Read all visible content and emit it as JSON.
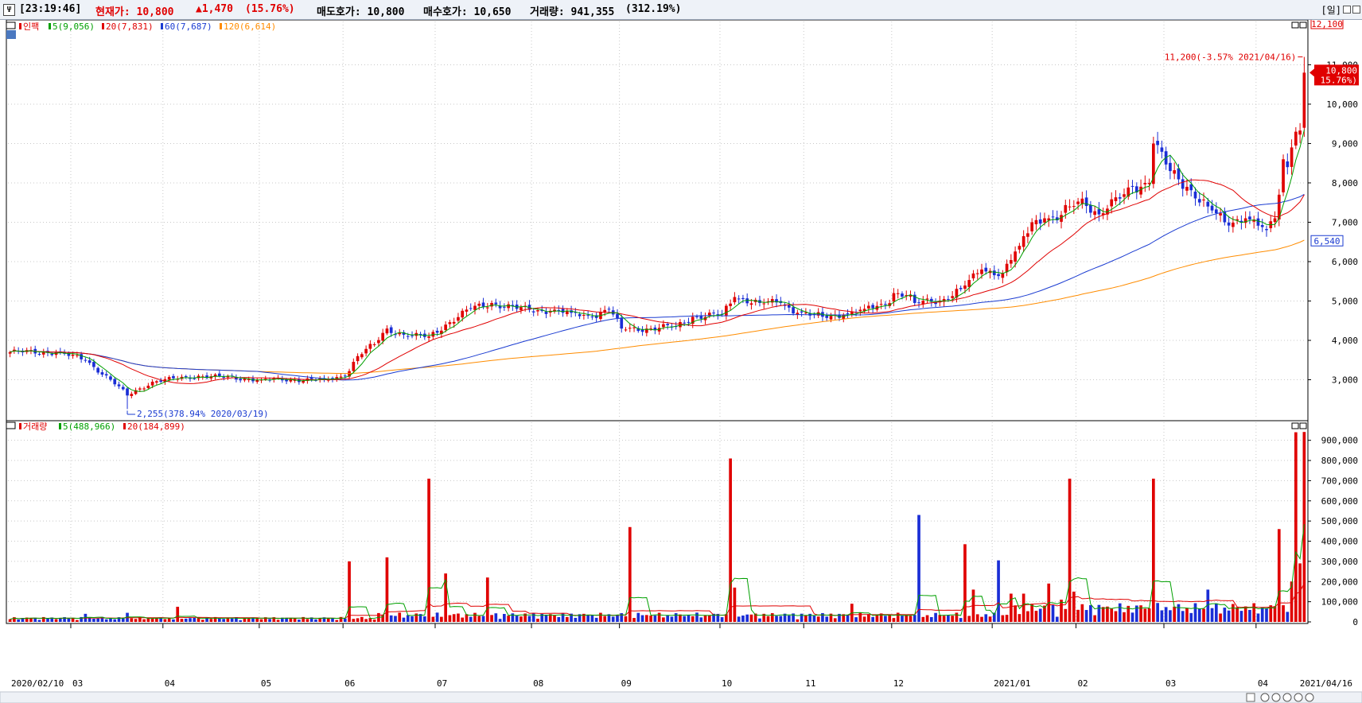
{
  "header": {
    "time": "[23:19:46]",
    "price_label": "현재가: 10,800",
    "change": "▲1,470",
    "change_pct": "(15.76%)",
    "ask": "매도호가: 10,800",
    "bid": "매수호가: 10,650",
    "volume": "거래량: 941,355",
    "volume_pct": "(312.19%)",
    "period": "[일]"
  },
  "price_legend": [
    {
      "text": "인팩",
      "color": "#e00000"
    },
    {
      "text": "5(9,056)",
      "color": "#00a000"
    },
    {
      "text": "20(7,831)",
      "color": "#e00000"
    },
    {
      "text": "60(7,687)",
      "color": "#1a3bd1"
    },
    {
      "text": "120(6,614)",
      "color": "#ff8c00"
    }
  ],
  "volume_legend": [
    {
      "text": "거래량",
      "color": "#e00000"
    },
    {
      "text": "5(488,966)",
      "color": "#00a000"
    },
    {
      "text": "20(184,899)",
      "color": "#e00000"
    }
  ],
  "annotations": {
    "high_label": "11,200(-3.57% 2021/04/16)",
    "low_label": "2,255(378.94% 2020/03/19)",
    "top_box": "12,100",
    "current_box_price": "10,800",
    "current_box_pct": "( 15.76%)",
    "low_box": "6,540"
  },
  "colors": {
    "up": "#e00000",
    "down": "#1a2ed6",
    "ma5": "#00a000",
    "ma20": "#e00000",
    "ma60": "#1a3bd1",
    "ma120": "#ff8c00"
  },
  "chart_data": [
    {
      "type": "candlestick",
      "title": "인팩",
      "ylim": [
        2000,
        12100
      ],
      "y_ticks": [
        3000,
        4000,
        5000,
        6000,
        7000,
        8000,
        9000,
        10000,
        11000
      ],
      "y_tick_labels": [
        "3,000",
        "4,000",
        "5,000",
        "6,000",
        "7,000",
        "8,000",
        "9,000",
        "10,000",
        "11,000"
      ],
      "x_ticks": [
        "2020/02/10",
        "03",
        "04",
        "05",
        "06",
        "07",
        "08",
        "09",
        "10",
        "11",
        "12",
        "2021/01",
        "02",
        "03",
        "04",
        "2021/04/16"
      ],
      "x_tick_dates": [
        "2020-02-10",
        "2020-03-02",
        "2020-04-01",
        "2020-05-04",
        "2020-06-01",
        "2020-07-01",
        "2020-08-03",
        "2020-09-01",
        "2020-10-05",
        "2020-11-02",
        "2020-12-01",
        "2021-01-04",
        "2021-02-01",
        "2021-03-02",
        "2021-04-01",
        "2021-04-16"
      ],
      "close_anchors": [
        [
          "2020-02-10",
          3700
        ],
        [
          "2020-02-25",
          3700
        ],
        [
          "2020-03-05",
          3500
        ],
        [
          "2020-03-13",
          3000
        ],
        [
          "2020-03-19",
          2600
        ],
        [
          "2020-03-27",
          2950
        ],
        [
          "2020-04-13",
          3100
        ],
        [
          "2020-05-04",
          3000
        ],
        [
          "2020-05-25",
          3000
        ],
        [
          "2020-06-01",
          3100
        ],
        [
          "2020-06-04",
          3600
        ],
        [
          "2020-06-10",
          3900
        ],
        [
          "2020-06-15",
          4300
        ],
        [
          "2020-06-22",
          4100
        ],
        [
          "2020-06-29",
          4100
        ],
        [
          "2020-07-03",
          4400
        ],
        [
          "2020-07-13",
          4800
        ],
        [
          "2020-07-20",
          4950
        ],
        [
          "2020-07-28",
          4800
        ],
        [
          "2020-08-07",
          4750
        ],
        [
          "2020-08-14",
          4700
        ],
        [
          "2020-08-21",
          4600
        ],
        [
          "2020-08-27",
          4800
        ],
        [
          "2020-09-01",
          4300
        ],
        [
          "2020-09-10",
          4300
        ],
        [
          "2020-09-18",
          4350
        ],
        [
          "2020-09-24",
          4600
        ],
        [
          "2020-10-05",
          4650
        ],
        [
          "2020-10-08",
          5100
        ],
        [
          "2020-10-16",
          4950
        ],
        [
          "2020-10-23",
          4950
        ],
        [
          "2020-10-29",
          4700
        ],
        [
          "2020-11-06",
          4600
        ],
        [
          "2020-11-13",
          4650
        ],
        [
          "2020-11-20",
          4800
        ],
        [
          "2020-11-27",
          4900
        ],
        [
          "2020-12-01",
          5200
        ],
        [
          "2020-12-04",
          5150
        ],
        [
          "2020-12-08",
          4950
        ],
        [
          "2020-12-17",
          5050
        ],
        [
          "2020-12-23",
          5300
        ],
        [
          "2020-12-30",
          5800
        ],
        [
          "2021-01-06",
          5700
        ],
        [
          "2021-01-12",
          6400
        ],
        [
          "2021-01-15",
          7000
        ],
        [
          "2021-01-20",
          7100
        ],
        [
          "2021-01-25",
          7050
        ],
        [
          "2021-01-28",
          7400
        ],
        [
          "2021-02-02",
          7600
        ],
        [
          "2021-02-08",
          7200
        ],
        [
          "2021-02-15",
          7600
        ],
        [
          "2021-02-18",
          7900
        ],
        [
          "2021-02-24",
          8000
        ],
        [
          "2021-02-25",
          9000
        ],
        [
          "2021-03-03",
          8300
        ],
        [
          "2021-03-09",
          7900
        ],
        [
          "2021-03-16",
          7400
        ],
        [
          "2021-03-22",
          7000
        ],
        [
          "2021-03-29",
          7100
        ],
        [
          "2021-04-05",
          6800
        ],
        [
          "2021-04-07",
          7100
        ],
        [
          "2021-04-08",
          7700
        ],
        [
          "2021-04-09",
          8600
        ],
        [
          "2021-04-12",
          8400
        ],
        [
          "2021-04-13",
          8900
        ],
        [
          "2021-04-14",
          9300
        ],
        [
          "2021-04-15",
          9330
        ],
        [
          "2021-04-16",
          10800
        ]
      ],
      "extremes": {
        "low": [
          2255,
          "2020-03-19"
        ],
        "high": [
          11200,
          "2021-04-16"
        ]
      }
    },
    {
      "type": "bar",
      "title": "거래량",
      "ylim": [
        0,
        950000
      ],
      "y_ticks": [
        0,
        100000,
        200000,
        300000,
        400000,
        500000,
        600000,
        700000,
        800000,
        900000
      ],
      "y_tick_labels": [
        "0",
        "100,000",
        "200,000",
        "300,000",
        "400,000",
        "500,000",
        "600,000",
        "700,000",
        "800,000",
        "900,000"
      ],
      "spikes": [
        [
          "2020-03-05",
          40000
        ],
        [
          "2020-03-19",
          45000
        ],
        [
          "2020-04-06",
          75000
        ],
        [
          "2020-06-02",
          300000
        ],
        [
          "2020-06-15",
          320000
        ],
        [
          "2020-06-29",
          710000
        ],
        [
          "2020-07-03",
          240000
        ],
        [
          "2020-07-17",
          220000
        ],
        [
          "2020-09-03",
          470000
        ],
        [
          "2020-10-07",
          810000
        ],
        [
          "2020-10-08",
          170000
        ],
        [
          "2020-11-17",
          90000
        ],
        [
          "2020-12-09",
          530000
        ],
        [
          "2020-12-24",
          385000
        ],
        [
          "2020-12-28",
          160000
        ],
        [
          "2021-01-05",
          305000
        ],
        [
          "2021-01-08",
          140000
        ],
        [
          "2021-01-13",
          140000
        ],
        [
          "2021-01-21",
          190000
        ],
        [
          "2021-01-26",
          110000
        ],
        [
          "2021-01-28",
          710000
        ],
        [
          "2021-01-29",
          150000
        ],
        [
          "2021-02-25",
          710000
        ],
        [
          "2021-03-16",
          160000
        ],
        [
          "2021-04-08",
          460000
        ],
        [
          "2021-04-13",
          200000
        ],
        [
          "2021-04-14",
          940000
        ],
        [
          "2021-04-15",
          290000
        ],
        [
          "2021-04-16",
          941355
        ]
      ],
      "ma5_last": 488966,
      "ma20_last": 184899
    }
  ]
}
